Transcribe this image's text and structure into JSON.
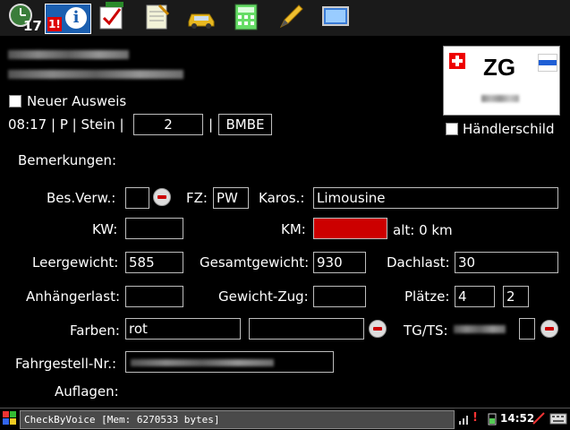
{
  "toolbar": {
    "calendar_day": "17",
    "alert_badge": "1!"
  },
  "header": {
    "new_id_label": "Neuer Ausweis",
    "status_line": "08:17 | P | Stein |",
    "count_value": "2",
    "separator": "|",
    "code_value": "BMBE",
    "plate_canton": "ZG",
    "dealer_plate_label": "Händlerschild"
  },
  "form": {
    "remarks_label": "Bemerkungen:",
    "bes_verw_label": "Bes.Verw.:",
    "fz_label": "FZ:",
    "fz_value": "PW",
    "karos_label": "Karos.:",
    "karos_value": "Limousine",
    "kw_label": "KW:",
    "km_label": "KM:",
    "km_old": "alt: 0 km",
    "leergewicht_label": "Leergewicht:",
    "leergewicht_value": "585",
    "gesamtgewicht_label": "Gesamtgewicht:",
    "gesamtgewicht_value": "930",
    "dachlast_label": "Dachlast:",
    "dachlast_value": "30",
    "anhaengerlast_label": "Anhängerlast:",
    "gewicht_zug_label": "Gewicht-Zug:",
    "plaetze_label": "Plätze:",
    "plaetze_value1": "4",
    "plaetze_value2": "2",
    "farben_label": "Farben:",
    "farben_value": "rot",
    "tgts_label": "TG/TS:",
    "fahrgestell_label": "Fahrgestell-Nr.:",
    "auflagen_label": "Auflagen:"
  },
  "taskbar": {
    "app_title": "CheckByVoice [Mem: 6270533 bytes]",
    "clock": "14:52"
  },
  "colors": {
    "background": "#000000",
    "km_field_fill": "#cc0000",
    "minus_red": "#cc0000"
  }
}
